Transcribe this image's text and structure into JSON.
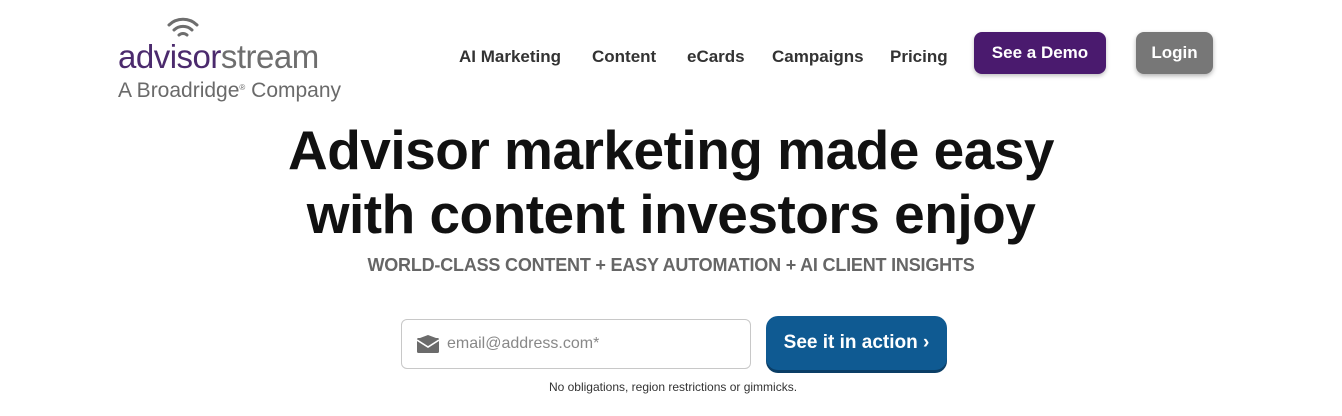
{
  "logo": {
    "word_part1": "advisor",
    "word_part2": "stream",
    "tagline_before": "A Broadridge",
    "tagline_mark": "®",
    "tagline_after": " Company",
    "icon": "wifi-signal-icon"
  },
  "nav": {
    "items": [
      {
        "label": "AI Marketing"
      },
      {
        "label": "Content"
      },
      {
        "label": "eCards"
      },
      {
        "label": "Campaigns"
      },
      {
        "label": "Pricing"
      }
    ],
    "demo_label": "See a Demo",
    "login_label": "Login"
  },
  "hero": {
    "headline_line1": "Advisor marketing made easy",
    "headline_line2": "with content investors enjoy",
    "subhead": "WORLD-CLASS CONTENT + EASY AUTOMATION + AI CLIENT INSIGHTS"
  },
  "form": {
    "email_placeholder": "email@address.com*",
    "email_value": "",
    "email_icon": "envelope-icon",
    "submit_label": "See it in action ›",
    "disclaimer": "No obligations, region restrictions or gimmicks."
  },
  "colors": {
    "brand_purple": "#4a1a6e",
    "login_gray": "#777777",
    "action_blue": "#0f5a92",
    "headline": "#111111",
    "subhead": "#666666"
  }
}
